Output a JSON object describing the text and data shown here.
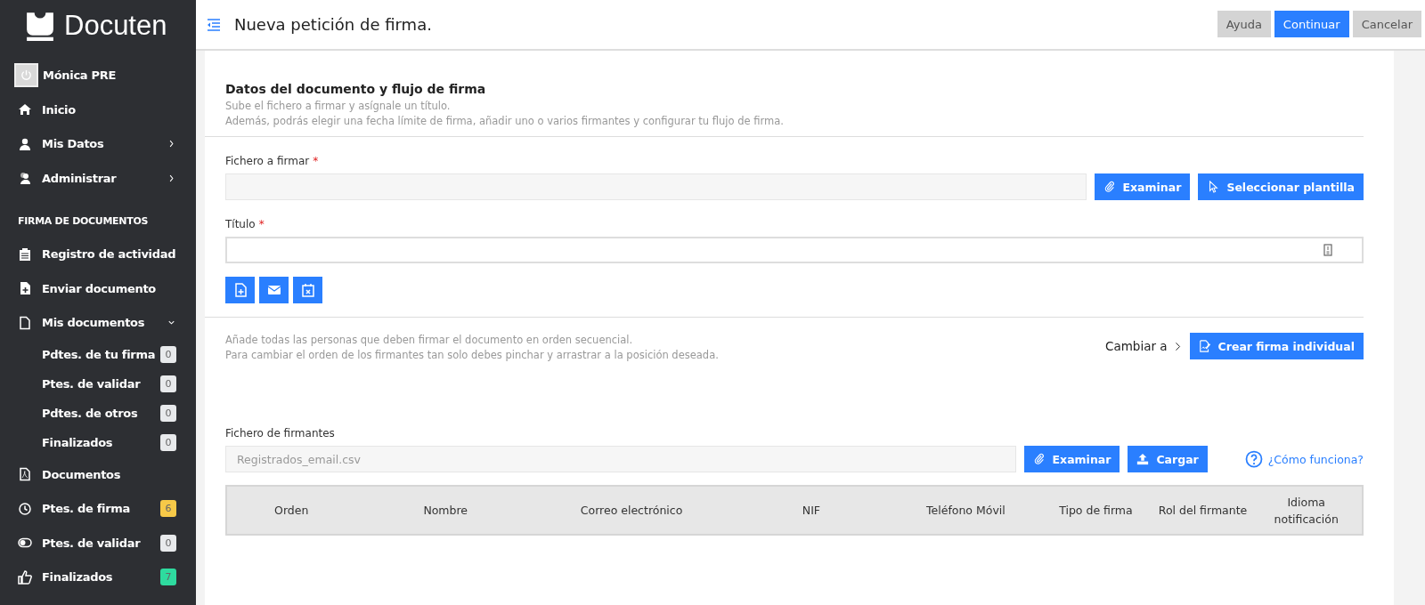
{
  "sidebar": {
    "logo": "Docuten",
    "user": "Mónica PRE",
    "items": [
      {
        "label": "Inicio"
      },
      {
        "label": "Mis Datos",
        "expanded": false
      },
      {
        "label": "Administrar",
        "expanded": false
      }
    ],
    "section_title": "FIRMA DE DOCUMENTOS",
    "section_items": [
      {
        "label": "Registro de actividad"
      },
      {
        "label": "Enviar documento"
      },
      {
        "label": "Mis documentos",
        "expanded": true,
        "children": [
          {
            "label": "Pdtes. de tu firma",
            "count": "0",
            "color": "#e8eaec"
          },
          {
            "label": "Ptes. de validar",
            "count": "0",
            "color": "#e8eaec"
          },
          {
            "label": "Pdtes. de otros",
            "count": "0",
            "color": "#e8eaec"
          },
          {
            "label": "Finalizados",
            "count": "0",
            "color": "#e8eaec"
          }
        ]
      },
      {
        "label": "Documentos"
      },
      {
        "label": "Ptes. de firma",
        "count": "6",
        "color": "#f7c948"
      },
      {
        "label": "Ptes. de validar",
        "count": "0",
        "color": "#e8eaec"
      },
      {
        "label": "Finalizados",
        "count": "7",
        "color": "#2edb9f"
      }
    ]
  },
  "header": {
    "title": "Nueva petición de firma.",
    "buttons": [
      {
        "label": "Ayuda",
        "kind": "secondary"
      },
      {
        "label": "Continuar",
        "kind": "primary"
      },
      {
        "label": "Cancelar",
        "kind": "secondary"
      }
    ]
  },
  "document_section": {
    "title": "Datos del documento y flujo de firma",
    "description": [
      "Sube el fichero a firmar y asígnale un título.",
      "Además, podrás elegir una fecha límite de firma, añadir uno o varios firmantes y configurar tu flujo de firma."
    ],
    "file_field": {
      "label": "Fichero a firmar",
      "required_mark": "*",
      "buttons": [
        "Examinar",
        "Seleccionar plantilla"
      ]
    },
    "title_field": {
      "label": "Título",
      "required_mark": "*"
    }
  },
  "signers_section": {
    "description": [
      "Añade todas las personas que deben firmar el documento en orden secuencial.",
      "Para cambiar el orden de los firmantes tan solo debes pinchar y arrastrar a la posición deseada."
    ],
    "switch_label": "Cambiar a",
    "switch_button": "Crear firma individual",
    "file_field": {
      "label": "Fichero de firmantes",
      "value": "Registrados_email.csv",
      "browse_button": "Examinar",
      "upload_button": "Cargar"
    },
    "help_link": "¿Cómo funciona?",
    "table": {
      "columns": [
        "Orden",
        "Nombre",
        "Correo electrónico",
        "NIF",
        "Teléfono Móvil",
        "Tipo de firma",
        "Rol del firmante",
        "Idioma notificación"
      ]
    }
  }
}
